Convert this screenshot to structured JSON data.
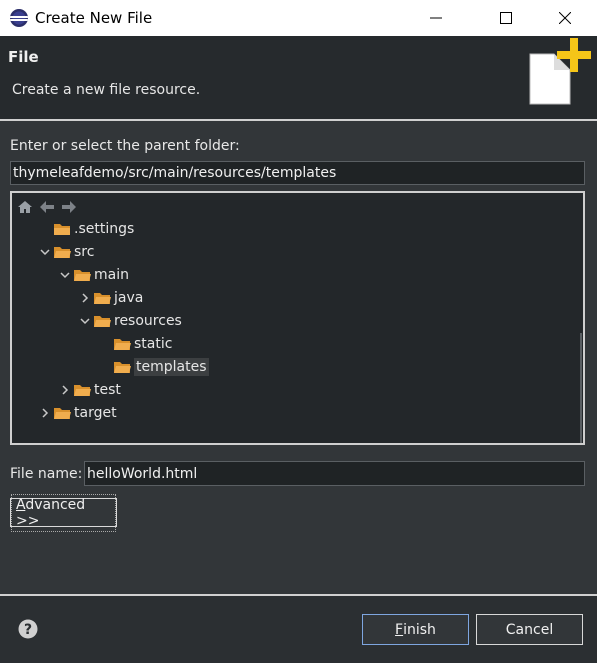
{
  "window": {
    "title": "Create New File"
  },
  "header": {
    "title": "File",
    "description": "Create a new file resource."
  },
  "parent_folder": {
    "label": "Enter or select the parent folder:",
    "value": "thymeleafdemo/src/main/resources/templates"
  },
  "tree": {
    "items": [
      {
        "label": ".settings",
        "expanded": null
      },
      {
        "label": "src",
        "expanded": true
      },
      {
        "label": "main",
        "expanded": true
      },
      {
        "label": "java",
        "expanded": false
      },
      {
        "label": "resources",
        "expanded": true
      },
      {
        "label": "static",
        "expanded": null
      },
      {
        "label": "templates",
        "expanded": null,
        "selected": true
      },
      {
        "label": "test",
        "expanded": false
      },
      {
        "label": "target",
        "expanded": false
      }
    ]
  },
  "file_name": {
    "label": "File name:",
    "value": "helloWorld.html"
  },
  "buttons": {
    "advanced_first": "A",
    "advanced_rest": "dvanced >>",
    "finish_first": "F",
    "finish_rest": "inish",
    "cancel": "Cancel"
  },
  "colors": {
    "accent": "#f5c518",
    "folder": "#e0a040",
    "dialog_bg": "#323639"
  }
}
